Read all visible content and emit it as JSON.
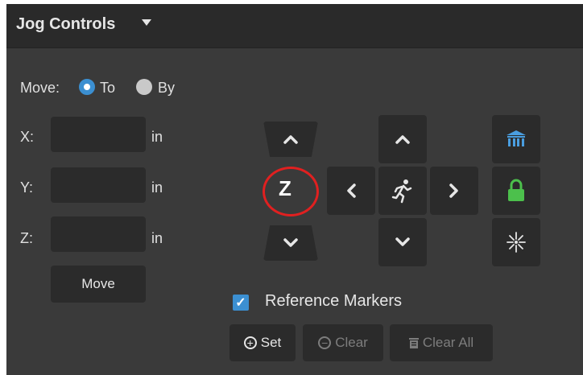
{
  "panel": {
    "title": "Jog Controls",
    "collapse_icon": "caret-down-icon"
  },
  "move_mode": {
    "label": "Move:",
    "options": [
      "To",
      "By"
    ],
    "selected": "To"
  },
  "axes": [
    {
      "label": "X:",
      "value": "",
      "unit": "in"
    },
    {
      "label": "Y:",
      "value": "",
      "unit": "in"
    },
    {
      "label": "Z:",
      "value": "",
      "unit": "in"
    }
  ],
  "move_button": "Move",
  "jog": {
    "z_label": "Z"
  },
  "reference_markers": {
    "label": "Reference Markers",
    "checked": true,
    "set_label": "Set",
    "clear_label": "Clear",
    "clear_all_label": "Clear All"
  },
  "colors": {
    "accent": "#3b8fd1",
    "lock": "#4cc04c",
    "highlight": "#e02020",
    "home": "#4a9ee0"
  }
}
